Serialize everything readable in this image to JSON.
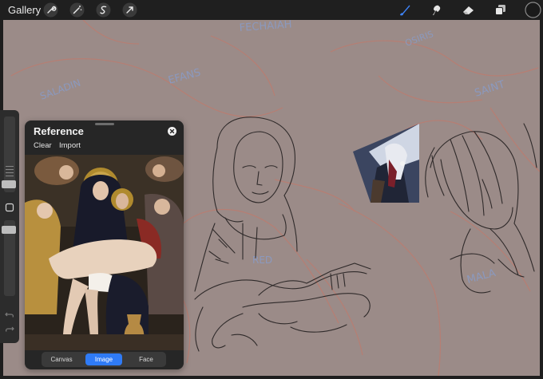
{
  "app": {
    "gallery_label": "Gallery",
    "toolbar_left": [
      {
        "name": "wrench-icon",
        "meaning": "actions"
      },
      {
        "name": "magic-wand-icon",
        "meaning": "adjustments"
      },
      {
        "name": "selection-icon",
        "meaning": "selection"
      },
      {
        "name": "transform-arrow-icon",
        "meaning": "transform"
      }
    ],
    "toolbar_right": [
      {
        "name": "brush-icon",
        "active": true
      },
      {
        "name": "smudge-icon",
        "active": false
      },
      {
        "name": "eraser-icon",
        "active": false
      },
      {
        "name": "layers-icon",
        "active": false
      },
      {
        "name": "color-swatch-icon",
        "active": false
      }
    ],
    "colors": {
      "accent": "#2f7bf6",
      "canvas": "#9b8b88",
      "toolbar": "#1f1f1f",
      "sketch_lines": "#2f2a2a",
      "underdrawing_red": "#c07a6c",
      "underdrawing_blue": "#8a9bc4",
      "current_color": "#1a1a1a"
    }
  },
  "sidebar": {
    "icons": [
      "brush-size-slider",
      "modify-button",
      "opacity-slider",
      "undo-icon",
      "redo-icon"
    ]
  },
  "canvas": {
    "annotations": [
      "FECHAIAH",
      "OSIRIS",
      "SALADIN",
      "EFANS",
      "SAINT",
      "RED",
      "MALA"
    ]
  },
  "reference": {
    "title": "Reference",
    "actions": [
      "Clear",
      "Import"
    ],
    "tabs": [
      "Canvas",
      "Image",
      "Face"
    ],
    "active_tab": "Image"
  }
}
